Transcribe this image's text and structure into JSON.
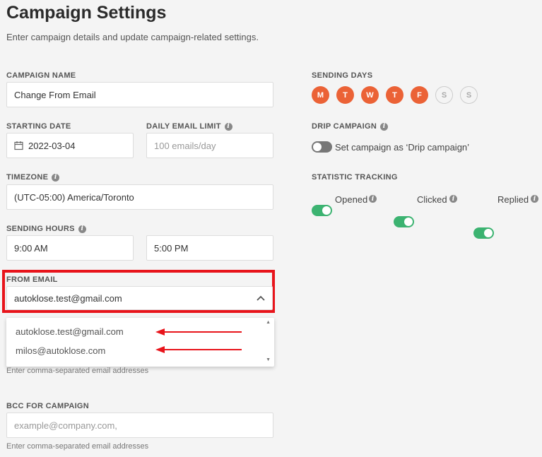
{
  "page": {
    "title": "Campaign Settings",
    "subtitle": "Enter campaign details and update campaign-related settings."
  },
  "campaign_name": {
    "label": "CAMPAIGN NAME",
    "value": "Change From Email"
  },
  "starting_date": {
    "label": "STARTING DATE",
    "value": "2022-03-04",
    "icon": "calendar-icon"
  },
  "daily_limit": {
    "label": "DAILY EMAIL LIMIT",
    "placeholder": "100 emails/day"
  },
  "timezone": {
    "label": "TIMEZONE",
    "value": "(UTC-05:00) America/Toronto"
  },
  "sending_hours": {
    "label": "SENDING HOURS",
    "start": "9:00 AM",
    "end": "5:00 PM"
  },
  "from_email": {
    "label": "FROM EMAIL",
    "value": "autoklose.test@gmail.com",
    "options": [
      "autoklose.test@gmail.com",
      "milos@autoklose.com"
    ]
  },
  "cc_hint": "Enter comma-separated email addresses",
  "bcc": {
    "label": "BCC FOR CAMPAIGN",
    "placeholder": "example@company.com,",
    "hint": "Enter comma-separated email addresses"
  },
  "sending_days": {
    "label": "SENDING DAYS",
    "days": [
      {
        "letter": "M",
        "active": true
      },
      {
        "letter": "T",
        "active": true
      },
      {
        "letter": "W",
        "active": true
      },
      {
        "letter": "T",
        "active": true
      },
      {
        "letter": "F",
        "active": true
      },
      {
        "letter": "S",
        "active": false
      },
      {
        "letter": "S",
        "active": false
      }
    ]
  },
  "drip_campaign": {
    "label": "DRIP CAMPAIGN",
    "toggle_label": "Set campaign as ‘Drip campaign’",
    "enabled": false
  },
  "statistic_tracking": {
    "label": "STATISTIC TRACKING",
    "items": [
      {
        "label": "Opened",
        "enabled": true
      },
      {
        "label": "Clicked",
        "enabled": true
      },
      {
        "label": "Replied",
        "enabled": true
      }
    ]
  },
  "colors": {
    "accent": "#eb6236",
    "toggle_on": "#3cb371",
    "highlight": "#e8141b"
  }
}
